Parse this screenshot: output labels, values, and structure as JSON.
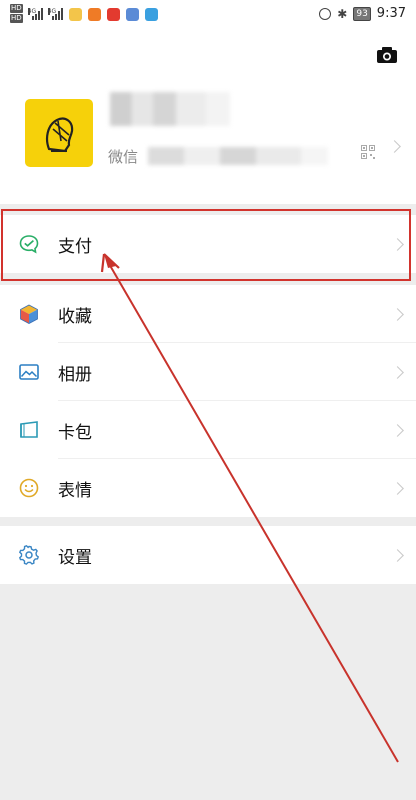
{
  "status": {
    "net_labels": [
      "HD",
      "HD"
    ],
    "signal_labels": [
      "4G",
      "4G"
    ],
    "battery": "93",
    "time": "9:37"
  },
  "profile": {
    "wechat_label": "微信"
  },
  "menu": {
    "pay": "支付",
    "favorites": "收藏",
    "album": "相册",
    "cards": "卡包",
    "stickers": "表情",
    "settings": "设置"
  },
  "colors": {
    "highlight": "#d2332d",
    "pay_icon": "#2aae67",
    "album_icon": "#2b7fc3",
    "cards_icon": "#2b9ab5",
    "stickers_icon": "#e0a928",
    "settings_icon": "#3a86c4"
  }
}
